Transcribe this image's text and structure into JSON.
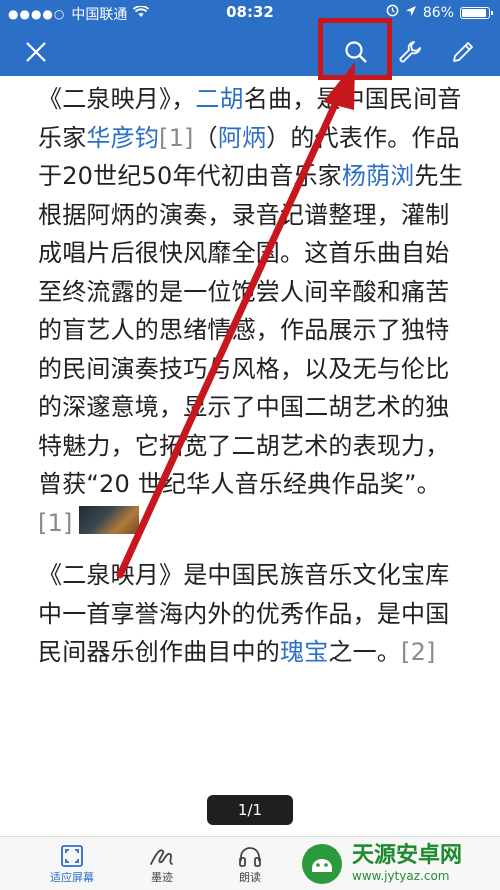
{
  "status_bar": {
    "signal": "●●●●○",
    "carrier": "中国联通",
    "time": "08:32",
    "battery": "86%"
  },
  "toolbar": {
    "close_icon": "close-icon",
    "search_icon": "search-icon",
    "tools_icon": "wrench-icon",
    "edit_icon": "pencil-icon"
  },
  "article": {
    "p1": {
      "s1": "《二泉映月》，",
      "l1": "二胡",
      "s2": "名曲，是中国民间音乐家",
      "l2": "华彦钧",
      "r1": "[1]",
      "s3": "（",
      "l3": "阿炳",
      "s4": "）的代表作。作品于20世纪50年代初由音乐家",
      "l4": "杨荫浏",
      "s5": "先生根据阿炳的演奏，录音记谱整理，灌制成唱片后很快风靡全国。这首乐曲自始至终流露的是一位饱尝人间辛酸和痛苦的盲艺人的思绪情感，作品展示了独特的民间演奏技巧与风格，以及无与伦比的深邃意境，显示了中国二胡艺术的独特魅力，它拓宽了二胡艺术的表现力，曾获“20 世纪华人音乐经典作品奖”。",
      "r2": "[1]"
    },
    "p2": {
      "s1": "《二泉映月》是中国民族音乐文化宝库中一首享誉海内外的优秀作品，是中国民间器乐创作曲目中的",
      "l1": "瑰宝",
      "s2": "之一。",
      "r1": "[2]"
    }
  },
  "pager": "1/1",
  "bottom_tabs": [
    {
      "label": "适应屏幕",
      "icon": "fit-screen-icon"
    },
    {
      "label": "墨迹",
      "icon": "ink-icon"
    },
    {
      "label": "朗读",
      "icon": "headphones-icon"
    }
  ],
  "watermark": {
    "title": "天源安卓网",
    "url": "www.jytyaz.com"
  },
  "colors": {
    "header": "#2b6fc6",
    "link": "#2b6fc6",
    "highlight": "#c8161d",
    "watermark": "#1a8a2c"
  }
}
